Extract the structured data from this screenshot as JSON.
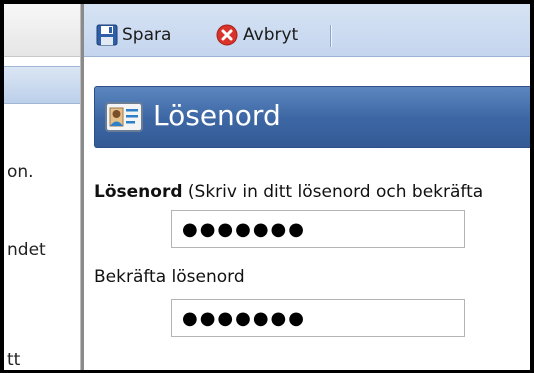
{
  "sidebar": {
    "fragments": [
      "on.",
      "ndet",
      "tt"
    ]
  },
  "toolbar": {
    "save_label": "Spara",
    "cancel_label": "Avbryt"
  },
  "panel": {
    "title": "Lösenord",
    "password_label": "Lösenord",
    "password_hint": " (Skriv in ditt lösenord och bekräfta",
    "confirm_label": "Bekräfta lösenord"
  },
  "fields": {
    "password_value": "●●●●●●●",
    "confirm_value": "●●●●●●●"
  },
  "colors": {
    "toolbar_bg": "#d0dff2",
    "title_bar": "#3c66a3",
    "cancel_icon": "#d9342b"
  }
}
